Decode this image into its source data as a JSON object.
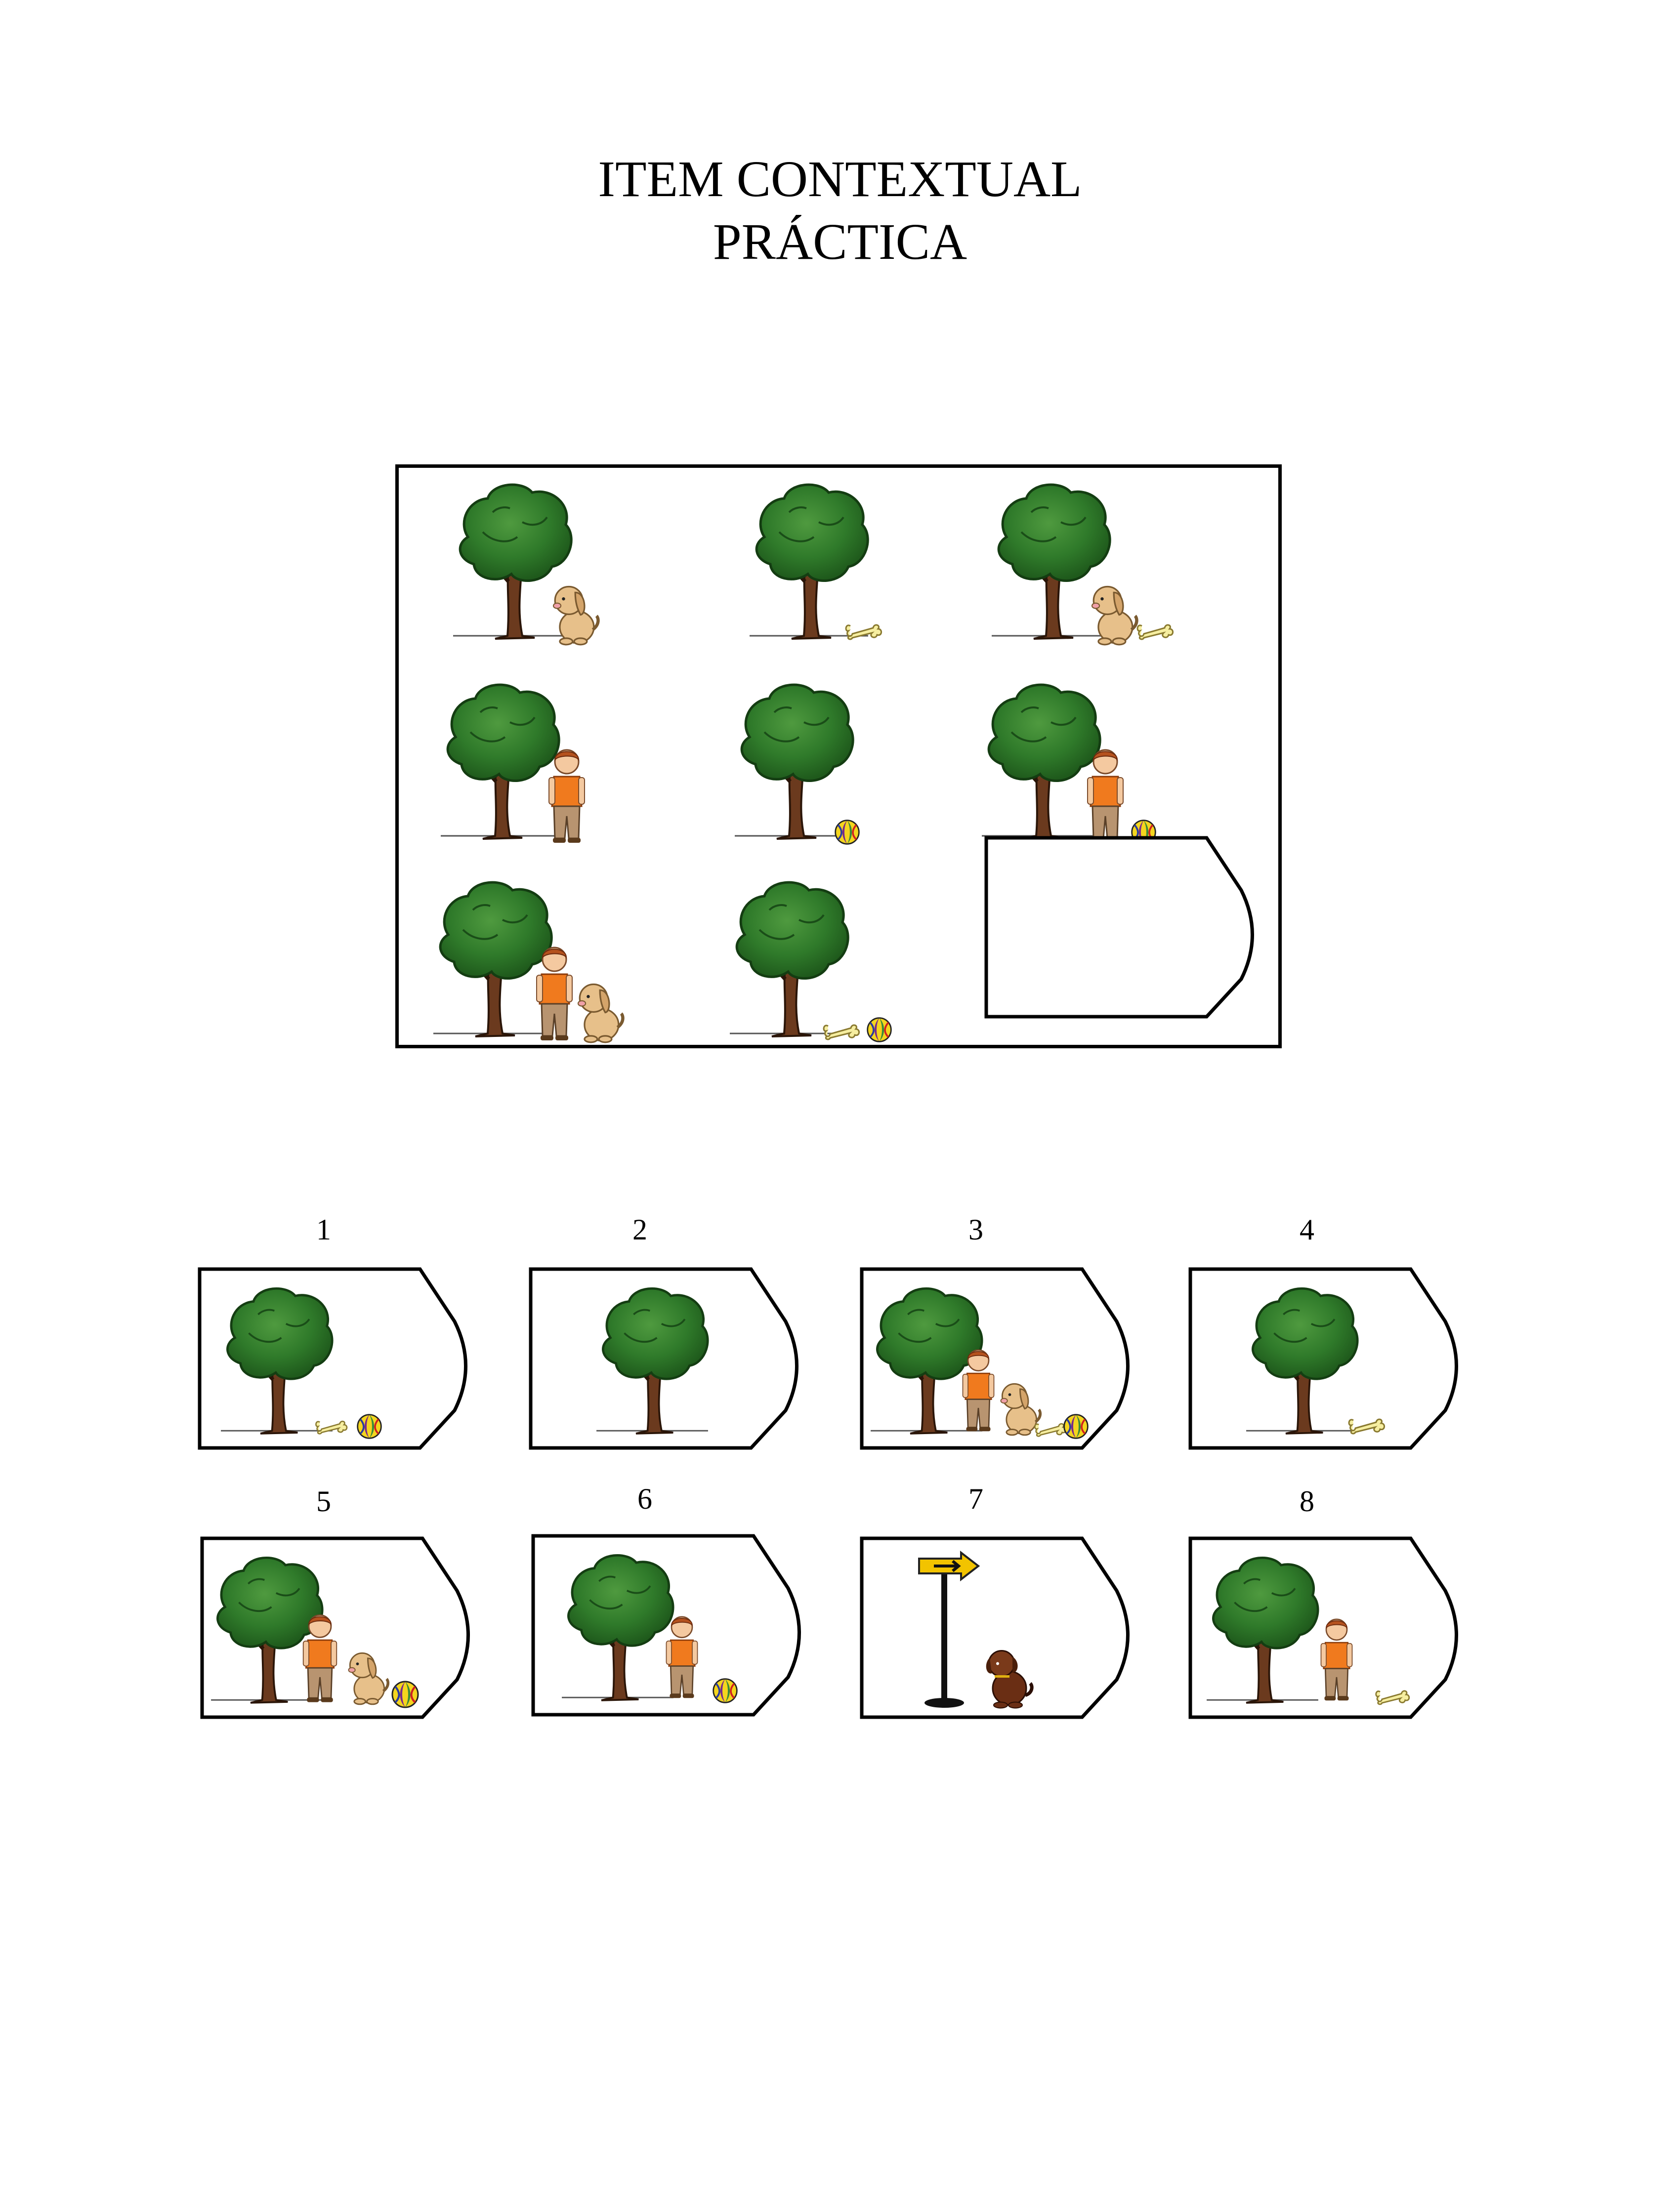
{
  "title": {
    "line1": "ITEM CONTEXTUAL",
    "line2": "PRÁCTICA"
  },
  "matrix": {
    "cells": [
      {
        "items": [
          "tree-icon",
          "dog-icon"
        ]
      },
      {
        "items": [
          "tree-icon",
          "bone-icon"
        ]
      },
      {
        "items": [
          "tree-icon",
          "dog-icon",
          "bone-icon"
        ]
      },
      {
        "items": [
          "tree-icon",
          "boy-icon"
        ]
      },
      {
        "items": [
          "tree-icon",
          "ball-icon"
        ]
      },
      {
        "items": [
          "tree-icon",
          "boy-icon",
          "ball-icon"
        ]
      },
      {
        "items": [
          "tree-icon",
          "boy-icon",
          "dog-icon"
        ]
      },
      {
        "items": [
          "tree-icon",
          "bone-icon",
          "ball-icon"
        ]
      },
      {
        "items": [
          "answer-slot"
        ]
      }
    ]
  },
  "options": [
    {
      "number": "1",
      "items": [
        "tree-icon",
        "bone-icon",
        "ball-icon"
      ]
    },
    {
      "number": "2",
      "items": [
        "tree-icon"
      ]
    },
    {
      "number": "3",
      "items": [
        "tree-icon",
        "boy-icon",
        "dog-icon",
        "bone-icon",
        "ball-icon"
      ]
    },
    {
      "number": "4",
      "items": [
        "tree-icon",
        "bone-icon"
      ]
    },
    {
      "number": "5",
      "items": [
        "tree-icon",
        "boy-icon",
        "dog-icon",
        "ball-icon"
      ]
    },
    {
      "number": "6",
      "items": [
        "tree-icon",
        "boy-icon",
        "ball-icon"
      ]
    },
    {
      "number": "7",
      "items": [
        "signpost-icon",
        "brown-dog-icon"
      ]
    },
    {
      "number": "8",
      "items": [
        "tree-icon",
        "boy-icon",
        "bone-icon"
      ]
    }
  ],
  "colors": {
    "tree_foliage": "#2f7a2a",
    "tree_trunk": "#6b3a1e",
    "boy_shirt": "#f07a1e",
    "dog": "#e7c08a",
    "brown_dog": "#6a2e14",
    "sign": "#f2c300"
  }
}
